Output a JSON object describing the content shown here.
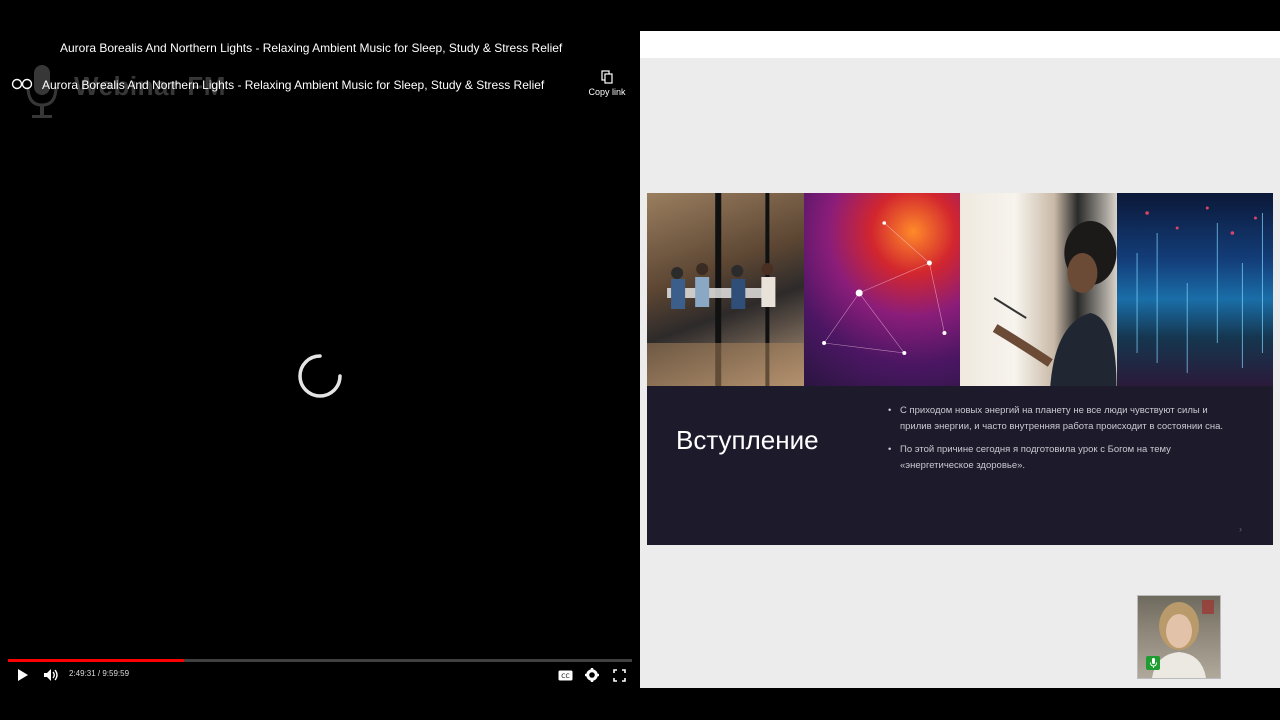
{
  "player": {
    "top_title": "Aurora Borealis And Northern Lights - Relaxing Ambient Music for Sleep, Study & Stress Relief",
    "video_title": "Aurora Borealis And Northern Lights - Relaxing Ambient Music for Sleep, Study & Stress Relief",
    "watermark": "Webinar FM",
    "copy_link_label": "Copy link",
    "time_display": "2:49:31 / 9:59:59",
    "progress_fraction": 0.2828,
    "icons": [
      "channel-icon",
      "copy-icon",
      "loading-spinner",
      "play-icon",
      "volume-icon",
      "captions-icon",
      "settings-icon",
      "fullscreen-icon"
    ],
    "accent_color": "#ff0000"
  },
  "slide": {
    "heading": "Вступление",
    "bullets": [
      "С приходом новых энергий на планету не все люди чувствуют силы и прилив энергии, и часто внутренняя работа происходит в состоянии сна.",
      "По этой причине сегодня я подготовила урок с Богом на тему «энергетическое здоровье»."
    ],
    "arrow": "›",
    "background_color": "#1d1b2b"
  },
  "webcam": {
    "mic_status_color": "#1f9d32"
  }
}
